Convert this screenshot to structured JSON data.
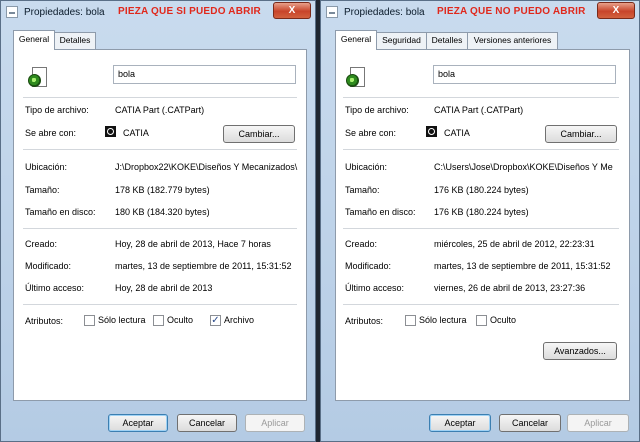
{
  "left_window": {
    "title": "Propiedades: bola",
    "annotation": "PIEZA QUE SI PUEDO ABRIR",
    "close_label": "X",
    "tabs": [
      "General",
      "Detalles"
    ],
    "name_value": "bola",
    "icons": {
      "file": "catpart-file-icon",
      "opens_with": "catia-app-icon"
    },
    "rows": {
      "file_type": {
        "label": "Tipo de archivo:",
        "value": "CATIA Part (.CATPart)"
      },
      "opens_with": {
        "label": "Se abre con:",
        "value": "CATIA"
      },
      "location": {
        "label": "Ubicación:",
        "value": "J:\\Dropbox22\\KOKE\\Diseños Y Mecanizados\\"
      },
      "size": {
        "label": "Tamaño:",
        "value": "178 KB (182.779 bytes)"
      },
      "size_on_disk": {
        "label": "Tamaño en disco:",
        "value": "180 KB (184.320 bytes)"
      },
      "created": {
        "label": "Creado:",
        "value": "Hoy, 28 de abril de 2013, Hace 7 horas"
      },
      "modified": {
        "label": "Modificado:",
        "value": "martes, 13 de septiembre de 2011, 15:31:52"
      },
      "accessed": {
        "label": "Último acceso:",
        "value": "Hoy, 28 de abril de 2013"
      }
    },
    "attributes": {
      "label": "Atributos:",
      "read_only": {
        "label": "Sólo lectura",
        "checked": false
      },
      "hidden": {
        "label": "Oculto",
        "checked": false
      },
      "archive": {
        "label": "Archivo",
        "checked": true
      }
    },
    "buttons": {
      "change": "Cambiar...",
      "ok": "Aceptar",
      "cancel": "Cancelar",
      "apply": "Aplicar"
    }
  },
  "right_window": {
    "title": "Propiedades: bola",
    "annotation": "PIEZA QUE NO PUEDO ABRIR",
    "close_label": "X",
    "tabs": [
      "General",
      "Seguridad",
      "Detalles",
      "Versiones anteriores"
    ],
    "name_value": "bola",
    "icons": {
      "file": "catpart-file-icon",
      "opens_with": "catia-app-icon"
    },
    "rows": {
      "file_type": {
        "label": "Tipo de archivo:",
        "value": "CATIA Part (.CATPart)"
      },
      "opens_with": {
        "label": "Se abre con:",
        "value": "CATIA"
      },
      "location": {
        "label": "Ubicación:",
        "value": "C:\\Users\\Jose\\Dropbox\\KOKE\\Diseños Y Me"
      },
      "size": {
        "label": "Tamaño:",
        "value": "176 KB (180.224 bytes)"
      },
      "size_on_disk": {
        "label": "Tamaño en disco:",
        "value": "176 KB (180.224 bytes)"
      },
      "created": {
        "label": "Creado:",
        "value": "miércoles, 25 de abril de 2012, 22:23:31"
      },
      "modified": {
        "label": "Modificado:",
        "value": "martes, 13 de septiembre de 2011, 15:31:52"
      },
      "accessed": {
        "label": "Último acceso:",
        "value": "viernes, 26 de abril de 2013, 23:27:36"
      }
    },
    "attributes": {
      "label": "Atributos:",
      "read_only": {
        "label": "Sólo lectura",
        "checked": false
      },
      "hidden": {
        "label": "Oculto",
        "checked": false
      }
    },
    "buttons": {
      "change": "Cambiar...",
      "advanced": "Avanzados...",
      "ok": "Aceptar",
      "cancel": "Cancelar",
      "apply": "Aplicar"
    }
  }
}
